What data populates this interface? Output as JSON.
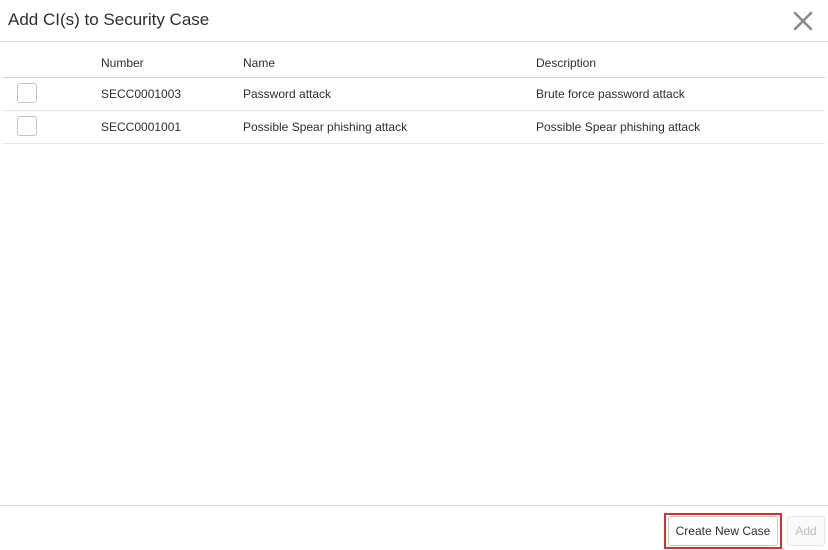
{
  "dialog": {
    "title": "Add CI(s) to Security Case",
    "close_icon": "close-icon"
  },
  "table": {
    "columns": [
      "Number",
      "Name",
      "Description"
    ],
    "rows": [
      {
        "number": "SECC0001003",
        "name": "Password attack",
        "description": "Brute force password attack",
        "checked": false
      },
      {
        "number": "SECC0001001",
        "name": "Possible Spear phishing attack",
        "description": "Possible Spear phishing attack",
        "checked": false
      }
    ]
  },
  "footer": {
    "create_label": "Create New Case",
    "add_label": "Add",
    "highlight_color": "#d93025"
  }
}
